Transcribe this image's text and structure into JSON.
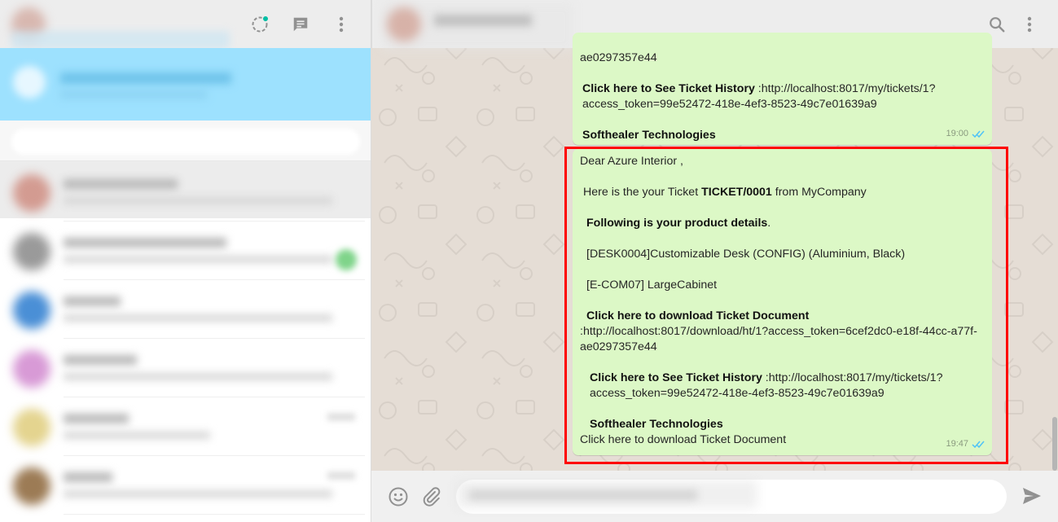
{
  "messages": {
    "previous": {
      "line_url_tail": "ae0297357e44",
      "history_label": "Click here to See Ticket History",
      "history_url": " :http://localhost:8017/my/tickets/1?access_token=99e52472-418e-4ef3-8523-49c7e01639a9",
      "company": "Softhealer Technologies",
      "time": "19:00"
    },
    "main": {
      "greeting": "Dear Azure Interior ,",
      "intro_prefix": "Here is the your Ticket ",
      "ticket_number": "TICKET/0001",
      "intro_suffix": " from MyCompany",
      "product_heading": "Following is your product details",
      "product_heading_tail": ".",
      "product_1": "[DESK0004]Customizable Desk (CONFIG) (Aluminium, Black)",
      "product_2": "[E-COM07] LargeCabinet",
      "download_label": "Click here to download Ticket Document",
      "download_url": ":http://localhost:8017/download/ht/1?access_token=6cef2dc0-e18f-44cc-a77f-ae0297357e44",
      "history_label": "Click here to See Ticket History",
      "history_url": " :http://localhost:8017/my/tickets/1?access_token=99e52472-418e-4ef3-8523-49c7e01639a9",
      "company": "Softhealer Technologies",
      "footer_line": "Click here to download Ticket Document",
      "time": "19:47"
    }
  },
  "colors": {
    "bubble_bg": "#dcf8c6",
    "highlight": "#ff0000",
    "read_ticks": "#4fc3f7",
    "banner": "#9de1fe",
    "status_dot": "#00bfa5"
  },
  "icons": {
    "status": "status-icon",
    "new_chat": "new-chat-icon",
    "menu": "menu-icon",
    "search": "search-icon",
    "emoji": "emoji-icon",
    "attach": "paperclip-icon",
    "send": "send-icon",
    "read": "double-check-icon"
  }
}
